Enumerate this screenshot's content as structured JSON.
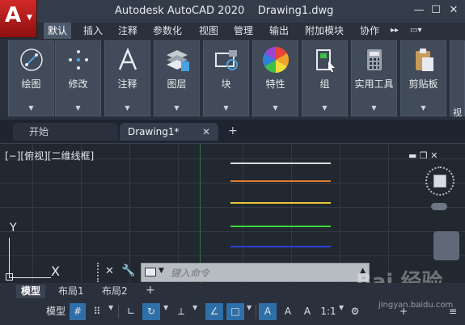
{
  "app": {
    "title": "Autodesk AutoCAD 2020",
    "document": "Drawing1.dwg",
    "logo_letter": "A",
    "accent": "#c0231f"
  },
  "window": {
    "minimize": "—",
    "restore": "☐",
    "close": "✕"
  },
  "ribbon_tabs": [
    {
      "label": "默认",
      "active": true
    },
    {
      "label": "插入"
    },
    {
      "label": "注释"
    },
    {
      "label": "参数化"
    },
    {
      "label": "视图"
    },
    {
      "label": "管理"
    },
    {
      "label": "输出"
    },
    {
      "label": "附加模块"
    },
    {
      "label": "协作"
    },
    {
      "label": "▸▸"
    },
    {
      "label": "▭▾"
    }
  ],
  "ribbon_panels": [
    {
      "label": "绘图",
      "icon": "draw-line-icon"
    },
    {
      "label": "修改",
      "icon": "move-icon"
    },
    {
      "label": "注释",
      "icon": "text-icon"
    },
    {
      "label": "图层",
      "icon": "layers-icon"
    },
    {
      "label": "块",
      "icon": "block-icon"
    },
    {
      "label": "特性",
      "icon": "color-wheel-icon"
    },
    {
      "label": "组",
      "icon": "group-icon"
    },
    {
      "label": "实用工具",
      "icon": "calculator-icon"
    },
    {
      "label": "剪贴板",
      "icon": "clipboard-icon"
    }
  ],
  "ribbon_overflow": "视",
  "file_tabs": {
    "start": "开始",
    "drawing": "Drawing1*",
    "close": "✕",
    "add": "+"
  },
  "viewport": {
    "label": "[−][俯视][二维线框]",
    "controls": "▬  ❐  ✕"
  },
  "drawing_lines": [
    {
      "color": "#d8d8d8"
    },
    {
      "color": "#e07a2c"
    },
    {
      "color": "#e8c83a"
    },
    {
      "color": "#3ad43a"
    },
    {
      "color": "#2a3fd8"
    }
  ],
  "ucs": {
    "x": "X",
    "y": "Y"
  },
  "command": {
    "placeholder": "键入命令",
    "close": "✕",
    "wrench": "🔧"
  },
  "layout_tabs": [
    {
      "label": "模型",
      "active": true
    },
    {
      "label": "布局1"
    },
    {
      "label": "布局2"
    }
  ],
  "layout_add": "+",
  "status": {
    "model": "模型",
    "grid": "#",
    "snap": "⠿",
    "ortho": "∟",
    "polar": "↻",
    "isodraft": "⟂",
    "osnap": "∠",
    "otrack": "□",
    "annotation": "A",
    "scale": "1:1",
    "gear": "⚙",
    "plus": "+",
    "customize": "≡"
  },
  "watermark": "Bai 经验",
  "watermark_sub": "jingyan.baidu.com"
}
